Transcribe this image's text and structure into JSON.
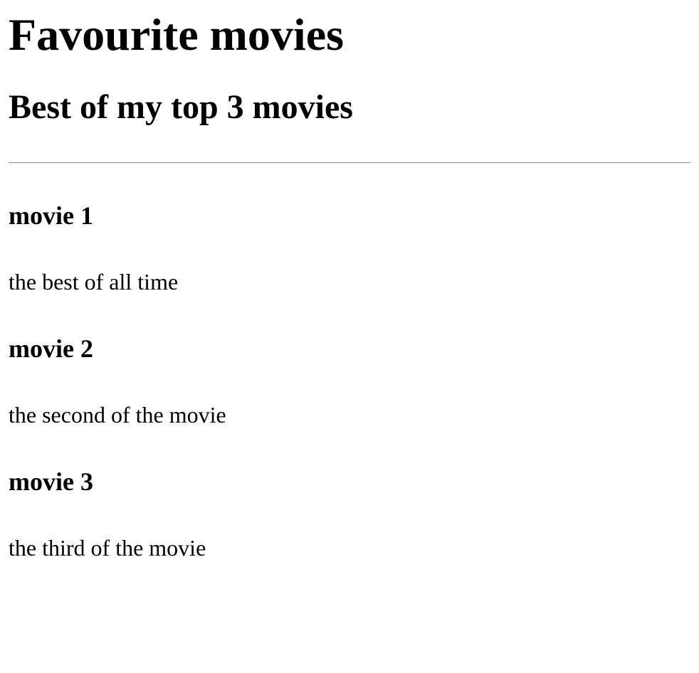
{
  "page": {
    "title": "Favourite movies",
    "subtitle": "Best of my top 3 movies"
  },
  "movies": [
    {
      "title": "movie 1",
      "description": "the best of all time"
    },
    {
      "title": "movie 2",
      "description": "the second of the movie"
    },
    {
      "title": "movie 3",
      "description": "the third of the movie"
    }
  ]
}
